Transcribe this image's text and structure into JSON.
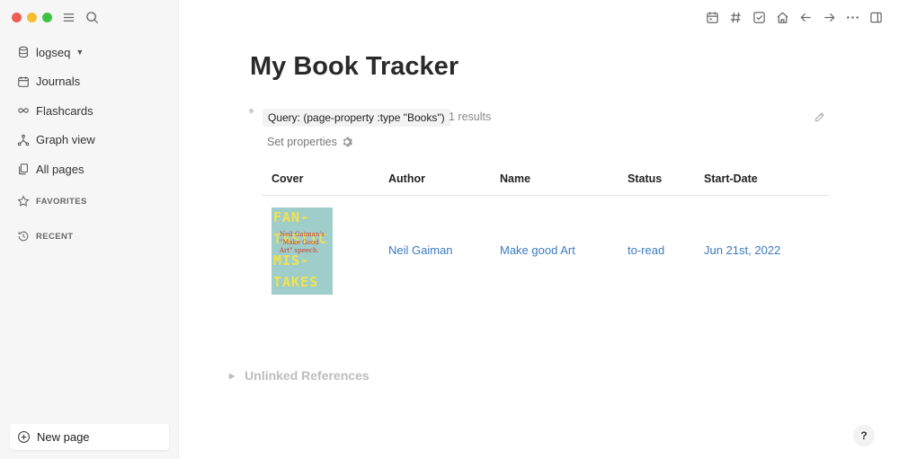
{
  "window": {
    "traffic_colors": [
      "#ee5e57",
      "#f5bd2f",
      "#3ec444"
    ]
  },
  "sidebar": {
    "graph_name": "logseq",
    "items": [
      {
        "label": "Journals",
        "icon": "calendar-icon"
      },
      {
        "label": "Flashcards",
        "icon": "infinity-icon"
      },
      {
        "label": "Graph view",
        "icon": "graph-icon"
      },
      {
        "label": "All pages",
        "icon": "pages-icon"
      }
    ],
    "favorites_label": "FAVORITES",
    "recent_label": "RECENT",
    "new_page_label": "New page"
  },
  "page": {
    "title": "My Book Tracker",
    "query_label": "Query: (page-property :type \"Books\")",
    "query_results": "1 results",
    "set_properties_label": "Set properties",
    "table": {
      "headers": [
        "Cover",
        "Author",
        "Name",
        "Status",
        "Start-Date"
      ],
      "rows": [
        {
          "cover": {
            "top_text": "FAN-",
            "mid1": "TASTIC",
            "mid2": "MIS-",
            "bottom_text": "TAKES",
            "subtitle": "Neil Gaiman's \"Make Good Art\" speech."
          },
          "author": "Neil Gaiman",
          "name": "Make good Art",
          "status": "to-read",
          "start_date": "Jun 21st, 2022"
        }
      ]
    },
    "unlinked_references_label": "Unlinked References"
  },
  "help_label": "?",
  "colors": {
    "link": "#3b7bbf",
    "sidebar_bg": "#f6f6f6"
  }
}
